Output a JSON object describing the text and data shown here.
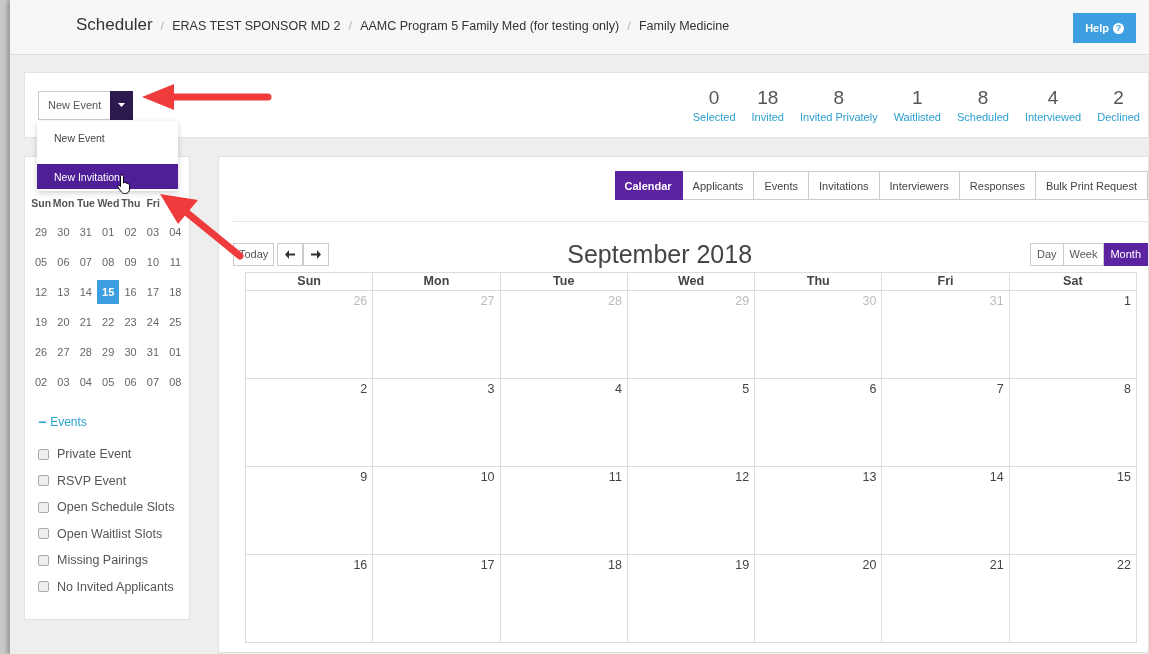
{
  "breadcrumb_separator": "/",
  "breadcrumb": [
    "Scheduler",
    "ERAS TEST SPONSOR MD 2",
    "AAMC Program 5 Family Med (for testing only)",
    "Family Medicine"
  ],
  "help_button": {
    "label": "Help",
    "icon": "?"
  },
  "new_event_button": {
    "label": "New Event"
  },
  "dropdown_menu": [
    {
      "label": "New Event",
      "selected": false
    },
    {
      "label": "New Invitation",
      "selected": true
    }
  ],
  "stats": [
    {
      "value": "0",
      "label": "Selected"
    },
    {
      "value": "18",
      "label": "Invited"
    },
    {
      "value": "8",
      "label": "Invited Privately"
    },
    {
      "value": "1",
      "label": "Waitlisted"
    },
    {
      "value": "8",
      "label": "Scheduled"
    },
    {
      "value": "4",
      "label": "Interviewed"
    },
    {
      "value": "2",
      "label": "Declined"
    }
  ],
  "mini_calendar": {
    "weekdays": [
      "Sun",
      "Mon",
      "Tue",
      "Wed",
      "Thu",
      "Fri"
    ],
    "weeks": [
      [
        {
          "day": "29",
          "selected": false
        },
        {
          "day": "30",
          "selected": false
        },
        {
          "day": "31",
          "selected": false
        },
        {
          "day": "01",
          "selected": false
        },
        {
          "day": "02",
          "selected": false
        },
        {
          "day": "03",
          "selected": false
        },
        {
          "day": "04",
          "selected": false
        }
      ],
      [
        {
          "day": "05",
          "selected": false
        },
        {
          "day": "06",
          "selected": false
        },
        {
          "day": "07",
          "selected": false
        },
        {
          "day": "08",
          "selected": false
        },
        {
          "day": "09",
          "selected": false
        },
        {
          "day": "10",
          "selected": false
        },
        {
          "day": "11",
          "selected": false
        }
      ],
      [
        {
          "day": "12",
          "selected": false
        },
        {
          "day": "13",
          "selected": false
        },
        {
          "day": "14",
          "selected": false
        },
        {
          "day": "15",
          "selected": true
        },
        {
          "day": "16",
          "selected": false
        },
        {
          "day": "17",
          "selected": false
        },
        {
          "day": "18",
          "selected": false
        }
      ],
      [
        {
          "day": "19",
          "selected": false
        },
        {
          "day": "20",
          "selected": false
        },
        {
          "day": "21",
          "selected": false
        },
        {
          "day": "22",
          "selected": false
        },
        {
          "day": "23",
          "selected": false
        },
        {
          "day": "24",
          "selected": false
        },
        {
          "day": "25",
          "selected": false
        }
      ],
      [
        {
          "day": "26",
          "selected": false
        },
        {
          "day": "27",
          "selected": false
        },
        {
          "day": "28",
          "selected": false
        },
        {
          "day": "29",
          "selected": false
        },
        {
          "day": "30",
          "selected": false
        },
        {
          "day": "31",
          "selected": false
        },
        {
          "day": "01",
          "selected": false
        }
      ],
      [
        {
          "day": "02",
          "selected": false
        },
        {
          "day": "03",
          "selected": false
        },
        {
          "day": "04",
          "selected": false
        },
        {
          "day": "05",
          "selected": false
        },
        {
          "day": "06",
          "selected": false
        },
        {
          "day": "07",
          "selected": false
        },
        {
          "day": "08",
          "selected": false
        }
      ]
    ]
  },
  "event_filters": {
    "toggle": "−",
    "title": "Events",
    "expanded": true,
    "items": [
      {
        "label": "Private Event",
        "checked": false
      },
      {
        "label": "RSVP Event",
        "checked": false
      },
      {
        "label": "Open Schedule Slots",
        "checked": false
      },
      {
        "label": "Open Waitlist Slots",
        "checked": false
      },
      {
        "label": "Missing Pairings",
        "checked": false
      },
      {
        "label": "No Invited Applicants",
        "checked": false
      }
    ]
  },
  "tabs": [
    {
      "label": "Calendar",
      "selected": true
    },
    {
      "label": "Applicants",
      "selected": false
    },
    {
      "label": "Events",
      "selected": false
    },
    {
      "label": "Invitations",
      "selected": false
    },
    {
      "label": "Interviewers",
      "selected": false
    },
    {
      "label": "Responses",
      "selected": false
    },
    {
      "label": "Bulk Print Request",
      "selected": false
    }
  ],
  "calendar": {
    "today_button": "Today",
    "title": "September 2018",
    "views": [
      {
        "label": "Day",
        "selected": false
      },
      {
        "label": "Week",
        "selected": false
      },
      {
        "label": "Month",
        "selected": true
      }
    ],
    "columns": [
      "Sun",
      "Mon",
      "Tue",
      "Wed",
      "Thu",
      "Fri",
      "Sat"
    ],
    "weeks": [
      [
        {
          "day": "26",
          "other_month": true
        },
        {
          "day": "27",
          "other_month": true
        },
        {
          "day": "28",
          "other_month": true
        },
        {
          "day": "29",
          "other_month": true
        },
        {
          "day": "30",
          "other_month": true
        },
        {
          "day": "31",
          "other_month": true
        },
        {
          "day": "1",
          "other_month": false
        }
      ],
      [
        {
          "day": "2",
          "other_month": false
        },
        {
          "day": "3",
          "other_month": false
        },
        {
          "day": "4",
          "other_month": false
        },
        {
          "day": "5",
          "other_month": false
        },
        {
          "day": "6",
          "other_month": false
        },
        {
          "day": "7",
          "other_month": false
        },
        {
          "day": "8",
          "other_month": false
        }
      ],
      [
        {
          "day": "9",
          "other_month": false
        },
        {
          "day": "10",
          "other_month": false
        },
        {
          "day": "11",
          "other_month": false
        },
        {
          "day": "12",
          "other_month": false
        },
        {
          "day": "13",
          "other_month": false
        },
        {
          "day": "14",
          "other_month": false
        },
        {
          "day": "15",
          "other_month": false
        }
      ],
      [
        {
          "day": "16",
          "other_month": false
        },
        {
          "day": "17",
          "other_month": false
        },
        {
          "day": "18",
          "other_month": false
        },
        {
          "day": "19",
          "other_month": false
        },
        {
          "day": "20",
          "other_month": false
        },
        {
          "day": "21",
          "other_month": false
        },
        {
          "day": "22",
          "other_month": false
        }
      ]
    ]
  }
}
